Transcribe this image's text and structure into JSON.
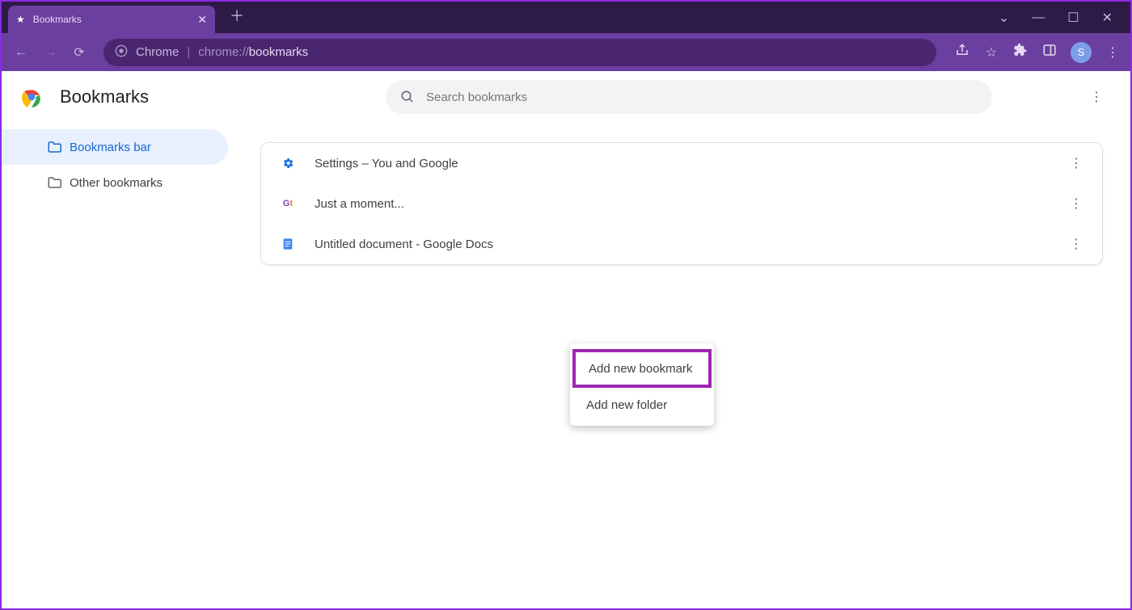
{
  "window": {
    "tab_title": "Bookmarks",
    "avatar_letter": "S"
  },
  "addressbar": {
    "app_label": "Chrome",
    "scheme": "chrome://",
    "path": "bookmarks"
  },
  "page": {
    "title": "Bookmarks",
    "search_placeholder": "Search bookmarks"
  },
  "sidebar": {
    "items": [
      {
        "label": "Bookmarks bar",
        "active": true
      },
      {
        "label": "Other bookmarks",
        "active": false
      }
    ]
  },
  "bookmarks": [
    {
      "title": "Settings – You and Google",
      "icon": "gear"
    },
    {
      "title": "Just a moment...",
      "icon": "gt"
    },
    {
      "title": "Untitled document - Google Docs",
      "icon": "docs"
    }
  ],
  "context_menu": {
    "items": [
      {
        "label": "Add new bookmark",
        "highlighted": true
      },
      {
        "label": "Add new folder",
        "highlighted": false
      }
    ]
  }
}
